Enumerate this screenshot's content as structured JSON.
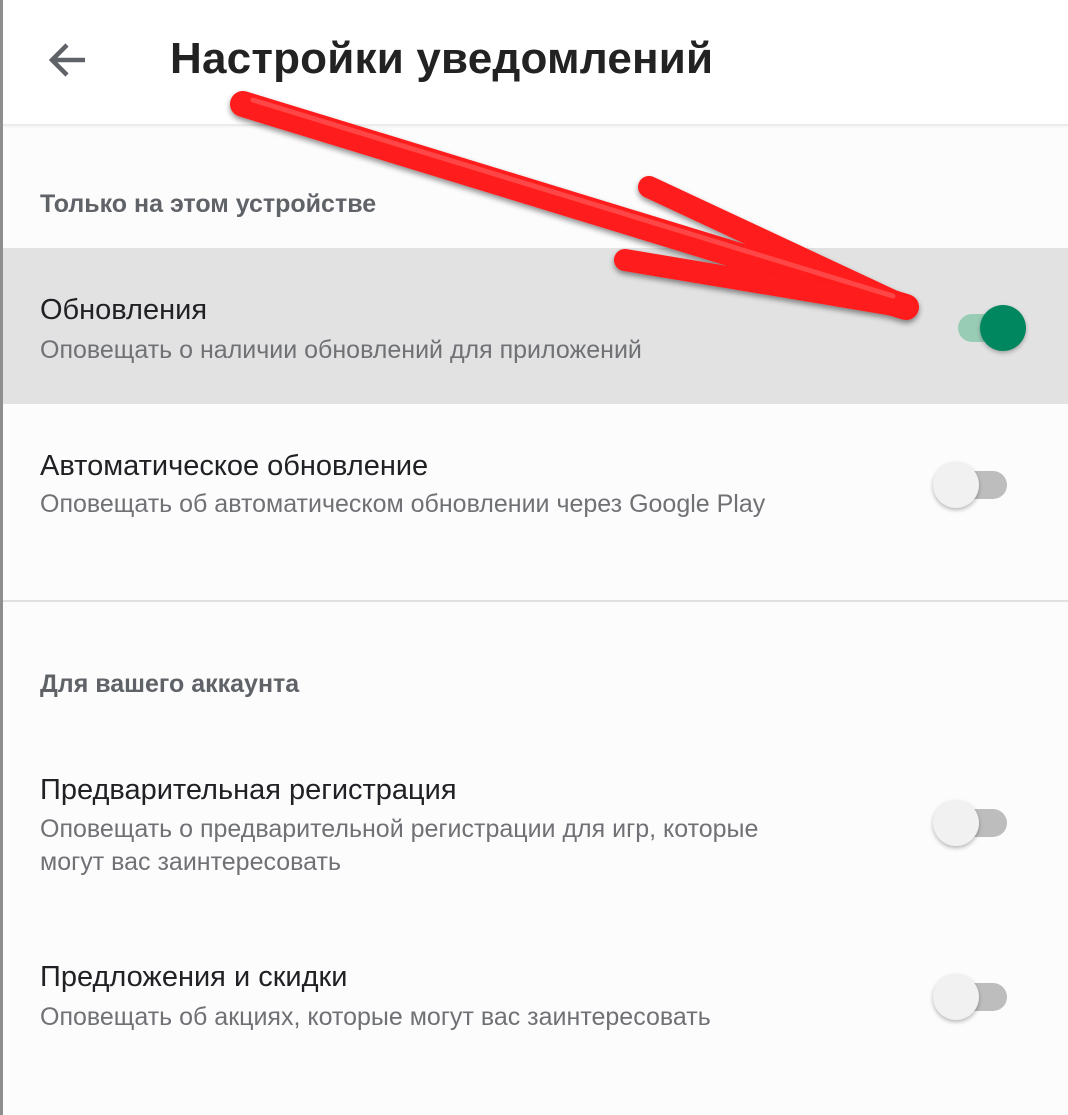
{
  "header": {
    "title": "Настройки уведомлений",
    "back_icon": "arrow-back-icon"
  },
  "sections": [
    {
      "header": "Только на этом устройстве",
      "items": [
        {
          "title": "Обновления",
          "subtitle": "Оповещать о наличии обновлений для приложений",
          "enabled": true
        },
        {
          "title": "Автоматическое обновление",
          "subtitle": "Оповещать об автоматическом обновлении через Google Play",
          "enabled": false
        }
      ]
    },
    {
      "header": "Для вашего аккаунта",
      "items": [
        {
          "title": "Предварительная регистрация",
          "subtitle_line1": "Оповещать о предварительной регистрации для игр, которые",
          "subtitle_line2": "могут вас заинтересовать",
          "enabled": false
        },
        {
          "title": "Предложения и скидки",
          "subtitle": "Оповещать об акциях, которые могут вас заинтересовать",
          "enabled": false
        }
      ]
    }
  ],
  "colors": {
    "accent": "#01875f",
    "highlight_row": "#e2e2e2",
    "annotation_arrow": "#ff1a1a"
  }
}
